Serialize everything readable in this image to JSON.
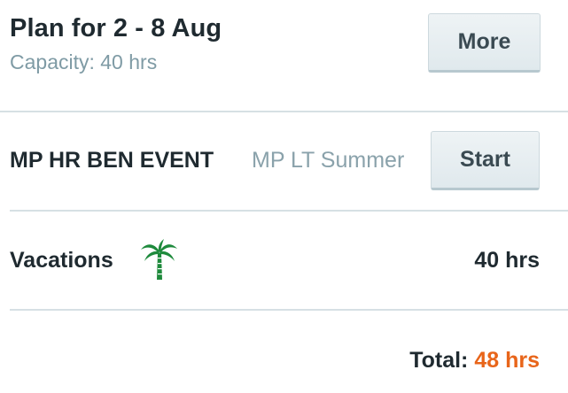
{
  "header": {
    "title": "Plan for 2 - 8 Aug",
    "capacity": "Capacity: 40 hrs",
    "more_label": "More"
  },
  "event": {
    "title": "MP HR BEN EVENT",
    "subtitle": "MP LT Summer",
    "start_label": "Start"
  },
  "vacation": {
    "label": "Vacations",
    "icon": "palm-tree-icon",
    "hours": "40 hrs"
  },
  "total": {
    "label": "Total:",
    "value": "48 hrs"
  },
  "colors": {
    "accent_total": "#e8651a",
    "subtle_text": "#7f9ba5",
    "palm_green": "#1e8a3c"
  }
}
